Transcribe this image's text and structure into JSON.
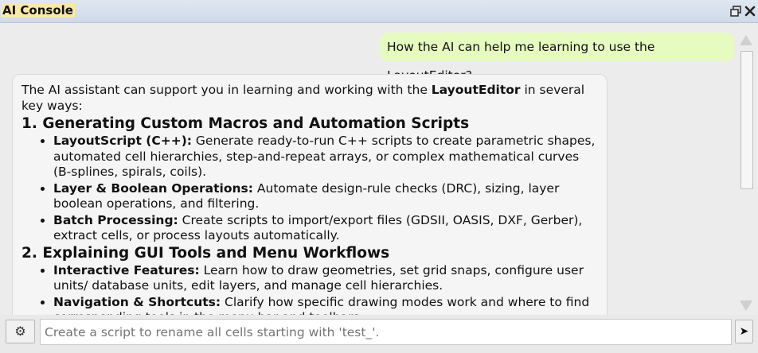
{
  "window": {
    "title": "AI Console"
  },
  "user_message": "How the AI can help me learning to use the LayoutEditor?",
  "ai_message": {
    "intro_prefix": "The AI assistant can support you in learning and working with the ",
    "intro_bold": "LayoutEditor",
    "intro_suffix": " in several key ways:",
    "section1": {
      "heading": "1. Generating Custom Macros and Automation Scripts",
      "items": [
        {
          "label": "LayoutScript (C++):",
          "text": " Generate ready-to-run C++ scripts to create parametric shapes, automated cell hierarchies, step-and-repeat arrays, or complex mathematical curves (B-splines, spirals, coils)."
        },
        {
          "label": "Layer & Boolean Operations:",
          "text": " Automate design-rule checks (DRC), sizing, layer boolean operations, and filtering."
        },
        {
          "label": "Batch Processing:",
          "text": " Create scripts to import/export files (GDSII, OASIS, DXF, Gerber), extract cells, or process layouts automatically."
        }
      ]
    },
    "section2": {
      "heading": "2. Explaining GUI Tools and Menu Workflows",
      "items": [
        {
          "label": "Interactive Features:",
          "text": " Learn how to draw geometries, set grid snaps, configure user units/ database units, edit layers, and manage cell hierarchies."
        },
        {
          "label": "Navigation & Shortcuts:",
          "text": " Clarify how specific drawing modes work and where to find corresponding tools in the menu bar and toolbars."
        }
      ]
    }
  },
  "input": {
    "placeholder": "Create a script to rename all cells starting with 'test_'."
  },
  "buttons": {
    "settings_glyph": "⚙",
    "send_glyph": "➤"
  },
  "colors": {
    "user_bubble": "#e6fbbf",
    "title_highlight": "#f8eaa6"
  }
}
